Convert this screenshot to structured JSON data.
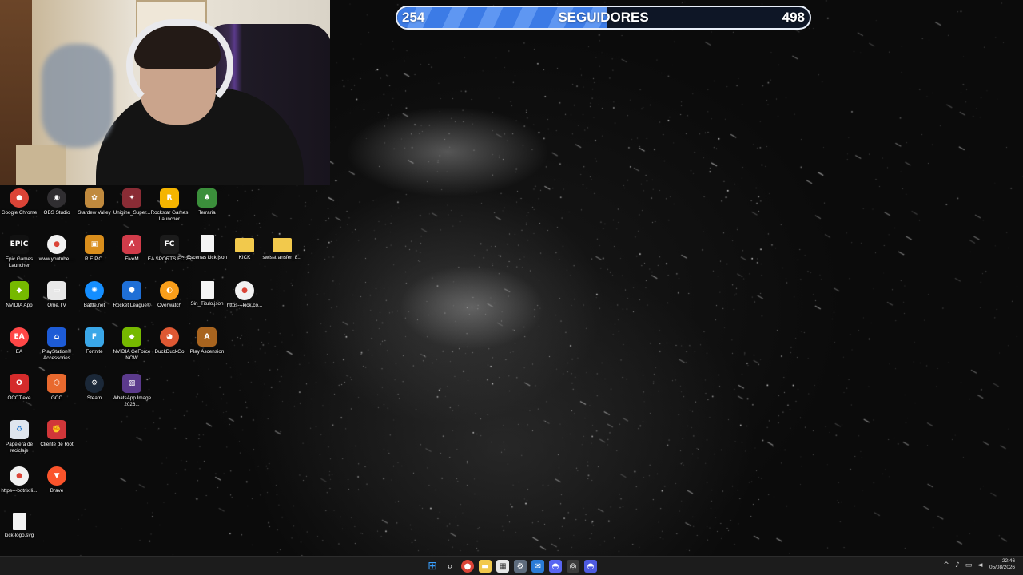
{
  "overlay": {
    "goal": {
      "current": "254",
      "label": "SEGUIDORES",
      "target": "498",
      "progress_fraction": 0.51,
      "fill_color": "#3c7be6",
      "border_color": "#e8eef8"
    }
  },
  "desktop_icons": [
    {
      "label": "Google Chrome",
      "icon": "chrome-icon",
      "color": "#db4437",
      "glyph": "●"
    },
    {
      "label": "OBS Studio",
      "icon": "obs-icon",
      "color": "#302e31",
      "glyph": "◉"
    },
    {
      "label": "Stardew Valley",
      "icon": "stardew-icon",
      "color": "#c08a3e",
      "glyph": "✿"
    },
    {
      "label": "Unigine_Super...",
      "icon": "unigine-icon",
      "color": "#8a2c35",
      "glyph": "✦"
    },
    {
      "label": "Rockstar Games Launcher",
      "icon": "rockstar-icon",
      "color": "#f4b400",
      "glyph": "R"
    },
    {
      "label": "Terraria",
      "icon": "terraria-icon",
      "color": "#3b8f3b",
      "glyph": "♣"
    },
    {
      "label": "Epic Games Launcher",
      "icon": "epic-games-icon",
      "color": "#111111",
      "glyph": "EPIC"
    },
    {
      "label": "www.youtube....",
      "icon": "chrome-shortcut-icon",
      "color": "#f1f1f1",
      "glyph": "●"
    },
    {
      "label": "R.E.P.O.",
      "icon": "repo-icon",
      "color": "#d98e1c",
      "glyph": "▣"
    },
    {
      "label": "FiveM",
      "icon": "fivem-icon",
      "color": "#d13c4a",
      "glyph": "Λ"
    },
    {
      "label": "EA SPORTS FC 26",
      "icon": "ea-fc-icon",
      "color": "#1b1b1b",
      "glyph": "FC"
    },
    {
      "label": "Escenas kick.json",
      "icon": "json-file-icon",
      "color": "#f4f4f4",
      "glyph": ""
    },
    {
      "label": "KICK",
      "icon": "folder-icon",
      "color": "#f2c94c",
      "glyph": ""
    },
    {
      "label": "swisstransfer_8...",
      "icon": "folder-icon",
      "color": "#f2c94c",
      "glyph": ""
    },
    {
      "label": "NVIDIA App",
      "icon": "nvidia-icon",
      "color": "#76b900",
      "glyph": "◆"
    },
    {
      "label": "Ome.TV",
      "icon": "ometv-icon",
      "color": "#e8e8e8",
      "glyph": "▭"
    },
    {
      "label": "Battle.net",
      "icon": "battlenet-icon",
      "color": "#148eff",
      "glyph": "✺"
    },
    {
      "label": "Rocket League®",
      "icon": "rocket-league-icon",
      "color": "#1f6fd6",
      "glyph": "⬢"
    },
    {
      "label": "Overwatch",
      "icon": "overwatch-icon",
      "color": "#f99e1a",
      "glyph": "◐"
    },
    {
      "label": "Sin_Titulo.json",
      "icon": "json-file-icon",
      "color": "#f4f4f4",
      "glyph": ""
    },
    {
      "label": "https---kick.co...",
      "icon": "chrome-shortcut-icon",
      "color": "#f1f1f1",
      "glyph": "●"
    },
    {
      "label": "EA",
      "icon": "ea-icon",
      "color": "#ff4747",
      "glyph": "EA"
    },
    {
      "label": "PlayStation® Accessories",
      "icon": "playstation-icon",
      "color": "#1d5bd6",
      "glyph": "⌂"
    },
    {
      "label": "Fortnite",
      "icon": "fortnite-icon",
      "color": "#3aa7e8",
      "glyph": "F"
    },
    {
      "label": "NVIDIA GeForce NOW",
      "icon": "geforce-now-icon",
      "color": "#76b900",
      "glyph": "◆"
    },
    {
      "label": "DuckDuckGo",
      "icon": "duckduckgo-icon",
      "color": "#de5833",
      "glyph": "◕"
    },
    {
      "label": "Play Ascension",
      "icon": "ascension-icon",
      "color": "#a8641f",
      "glyph": "A"
    },
    {
      "label": "OCCT.exe",
      "icon": "occt-icon",
      "color": "#d42b2b",
      "glyph": "O"
    },
    {
      "label": "GCC",
      "icon": "gcc-icon",
      "color": "#e8692e",
      "glyph": "⬡"
    },
    {
      "label": "Steam",
      "icon": "steam-icon",
      "color": "#1b2838",
      "glyph": "⚙"
    },
    {
      "label": "WhatsApp Image 2026...",
      "icon": "image-file-icon",
      "color": "#5b3a8c",
      "glyph": "▨"
    },
    {
      "label": "Papelera de reciclaje",
      "icon": "recycle-bin-icon",
      "color": "#dfe6ee",
      "glyph": "♻"
    },
    {
      "label": "Cliente de Riot",
      "icon": "riot-client-icon",
      "color": "#d13639",
      "glyph": "✊"
    },
    {
      "label": "https---botrix.li...",
      "icon": "chrome-shortcut-icon",
      "color": "#f1f1f1",
      "glyph": "●"
    },
    {
      "label": "Brave",
      "icon": "brave-icon",
      "color": "#fb542b",
      "glyph": "▼"
    },
    {
      "label": "kick-logo.svg",
      "icon": "svg-file-icon",
      "color": "#f4f4f4",
      "glyph": ""
    }
  ],
  "taskbar": {
    "apps": [
      {
        "name": "windows-start-icon",
        "color": "#3aa0ff",
        "glyph": "⊞"
      },
      {
        "name": "search-icon",
        "color": "transparent",
        "glyph": "⌕"
      },
      {
        "name": "chrome-icon",
        "color": "#db4437",
        "glyph": "●"
      },
      {
        "name": "file-explorer-icon",
        "color": "#f2c94c",
        "glyph": "▬"
      },
      {
        "name": "calendar-app-icon",
        "color": "#e6e6e6",
        "glyph": "▦"
      },
      {
        "name": "settings-icon",
        "color": "#5e6c7d",
        "glyph": "⚙"
      },
      {
        "name": "mail-icon",
        "color": "#2a7bd6",
        "glyph": "✉"
      },
      {
        "name": "discord-icon",
        "color": "#5865f2",
        "glyph": "◓"
      },
      {
        "name": "streaming-app-icon",
        "color": "#3a3a3a",
        "glyph": "◎"
      },
      {
        "name": "discord-alt-icon",
        "color": "#4e5be0",
        "glyph": "◓"
      }
    ],
    "tray": [
      {
        "name": "chevron-up-icon",
        "glyph": "^"
      },
      {
        "name": "microphone-icon",
        "glyph": "♪"
      },
      {
        "name": "network-icon",
        "glyph": "▭"
      },
      {
        "name": "volume-icon",
        "glyph": "◄"
      }
    ],
    "clock": {
      "time": "22:46",
      "date": "05/08/2026"
    }
  }
}
